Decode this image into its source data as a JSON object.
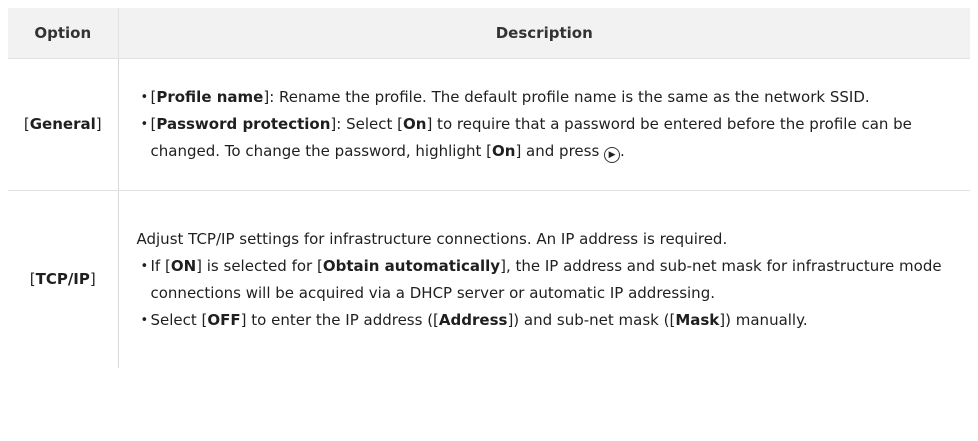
{
  "header": {
    "option": "Option",
    "description": "Description"
  },
  "rows": [
    {
      "option": "General",
      "bullets": [
        {
          "label": "Profile name",
          "text": ": Rename the profile. The default profile name is the same as the network SSID."
        },
        {
          "label": "Password protection",
          "text_a": ": Select [",
          "on1": "On",
          "text_b": "] to require that a password be entered before the profile can be changed. To change the password, highlight [",
          "on2": "On",
          "text_c": "] and press",
          "icon": "multi-selector-right-icon",
          "end": "."
        }
      ]
    },
    {
      "option": "TCP/IP",
      "intro": "Adjust TCP/IP settings for infrastructure connections. An IP address is required.",
      "bullets": [
        {
          "pre": "If [",
          "on": "ON",
          "mid": "] is selected for [",
          "label": "Obtain automatically",
          "text": "], the IP address and sub-net mask for infrastructure mode connections will be acquired via a DHCP server or automatic IP addressing."
        },
        {
          "pre": "Select [",
          "off": "OFF",
          "mid1": "] to enter the IP address ([",
          "address": "Address",
          "mid2": "]) and sub-net mask ([",
          "mask": "Mask",
          "end": "]) manually."
        }
      ]
    }
  ]
}
